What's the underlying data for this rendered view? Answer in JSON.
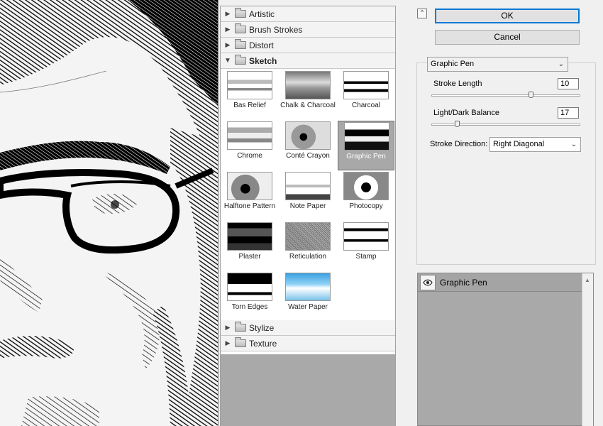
{
  "gallery": {
    "folders_before": [
      {
        "label": "Artistic"
      },
      {
        "label": "Brush Strokes"
      },
      {
        "label": "Distort"
      }
    ],
    "open_folder": {
      "label": "Sketch"
    },
    "thumbnails": [
      {
        "caption": "Bas Relief"
      },
      {
        "caption": "Chalk & Charcoal"
      },
      {
        "caption": "Charcoal"
      },
      {
        "caption": "Chrome"
      },
      {
        "caption": "Conté Crayon"
      },
      {
        "caption": "Graphic Pen",
        "selected": true
      },
      {
        "caption": "Halftone Pattern"
      },
      {
        "caption": "Note Paper"
      },
      {
        "caption": "Photocopy"
      },
      {
        "caption": "Plaster"
      },
      {
        "caption": "Reticulation"
      },
      {
        "caption": "Stamp"
      },
      {
        "caption": "Torn Edges"
      },
      {
        "caption": "Water Paper"
      }
    ],
    "folders_after": [
      {
        "label": "Stylize"
      },
      {
        "label": "Texture"
      }
    ]
  },
  "buttons": {
    "ok": "OK",
    "cancel": "Cancel",
    "collapse_icon": "double-chevron-up-icon"
  },
  "settings": {
    "filter": "Graphic Pen",
    "stroke_length": {
      "label": "Stroke Length",
      "value": "10",
      "max": 15
    },
    "light_dark_balance": {
      "label": "Light/Dark Balance",
      "value": "17",
      "max": 100
    },
    "stroke_direction": {
      "label": "Stroke Direction:",
      "value": "Right Diagonal"
    }
  },
  "layers": {
    "items": [
      {
        "name": "Graphic Pen",
        "visible": true,
        "icon": "eye-icon"
      }
    ]
  },
  "colors": {
    "accent": "#0078d7",
    "panel": "#f0f0f0",
    "selection": "#a8a8a8"
  }
}
